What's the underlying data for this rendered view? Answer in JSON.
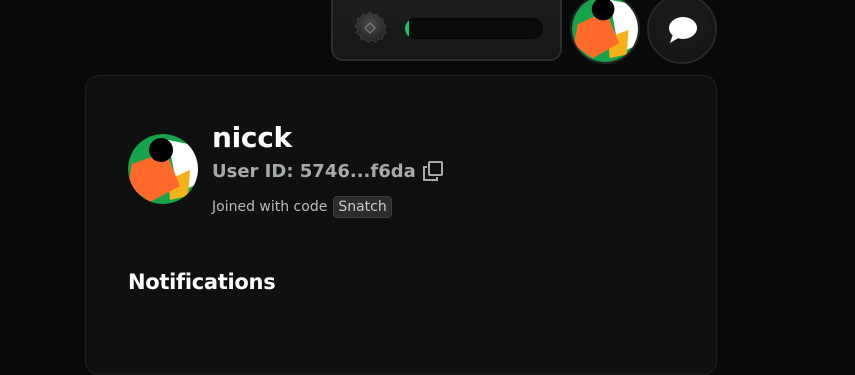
{
  "toolbar": {
    "token_icon": "coin-icon",
    "progress_fraction": 0.02,
    "progress_color": "#16c46a",
    "avatar_icon": "user-avatar",
    "chat_icon": "chat-bubble-icon"
  },
  "profile": {
    "username": "nicck",
    "user_id": "User ID: 5746...f6da",
    "copy_icon": "copy-icon",
    "joined_label": "Joined with code",
    "code": "Snatch"
  },
  "sections": {
    "notifications_title": "Notifications"
  },
  "colors": {
    "background": "#080909",
    "card": "#0f1110",
    "accent_green": "#16c46a",
    "avatar_orange": "#ff6a2a",
    "avatar_green": "#17a34a",
    "avatar_yellow": "#f3b21a"
  }
}
